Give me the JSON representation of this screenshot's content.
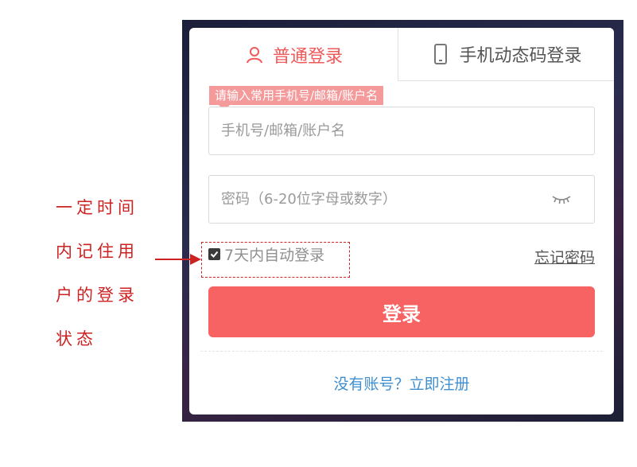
{
  "tabs": [
    {
      "label": "普通登录",
      "icon": "user-icon",
      "active": true
    },
    {
      "label": "手机动态码登录",
      "icon": "mobile-phone-icon",
      "active": false
    }
  ],
  "form": {
    "hint": "请输入常用手机号/邮箱/账户名",
    "username_placeholder": "手机号/邮箱/账户名",
    "password_placeholder": "密码（6-20位字母或数字）",
    "password_toggle_icon": "eye-closed-icon",
    "remember_label": "7天内自动登录",
    "remember_checked": true,
    "forgot_label": "忘记密码",
    "login_label": "登录",
    "register_label": "没有账号？立即注册"
  },
  "annotation": {
    "lines": [
      "一定时间",
      "内记住用",
      "户的登录",
      "状态"
    ]
  },
  "colors": {
    "accent": "#f0595a",
    "button": "#f66362",
    "hint_bg": "#f59a9b",
    "link": "#3f8fd0",
    "annotation": "#cc2222"
  }
}
